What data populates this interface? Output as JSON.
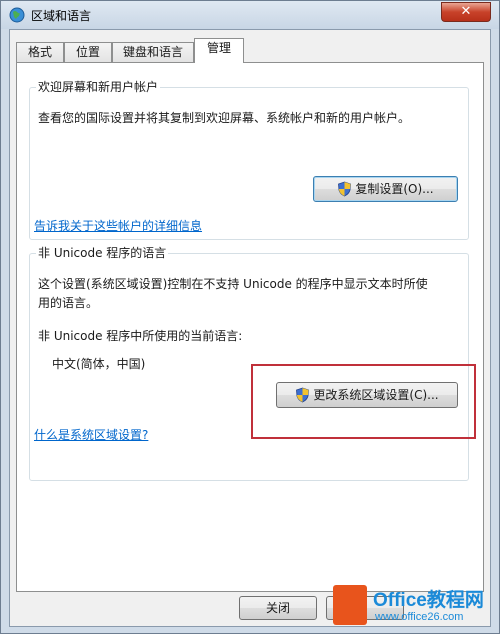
{
  "window": {
    "title": "区域和语言",
    "close_glyph": "✕"
  },
  "tabs": [
    {
      "label": "格式"
    },
    {
      "label": "位置"
    },
    {
      "label": "键盘和语言"
    },
    {
      "label": "管理"
    }
  ],
  "welcome_group": {
    "title": "欢迎屏幕和新用户帐户",
    "description": "查看您的国际设置并将其复制到欢迎屏幕、系统帐户和新的用户帐户。",
    "copy_button": "复制设置(O)...",
    "link": "告诉我关于这些帐户的详细信息"
  },
  "unicode_group": {
    "title": "非 Unicode 程序的语言",
    "description_line1": "这个设置(系统区域设置)控制在不支持 Unicode 的程序中显示文本时所使",
    "description_line2": "用的语言。",
    "current_label": "非 Unicode 程序中所使用的当前语言:",
    "current_value": "中文(简体，中国)",
    "change_button": "更改系统区域设置(C)...",
    "link": "什么是系统区域设置?"
  },
  "footer": {
    "close_button": "关闭"
  },
  "watermark": {
    "brand": "Office教程网",
    "url": "www.office26.com"
  },
  "colors": {
    "highlight": "#c0303a",
    "link": "#0066cc",
    "close": "#c8422a"
  }
}
